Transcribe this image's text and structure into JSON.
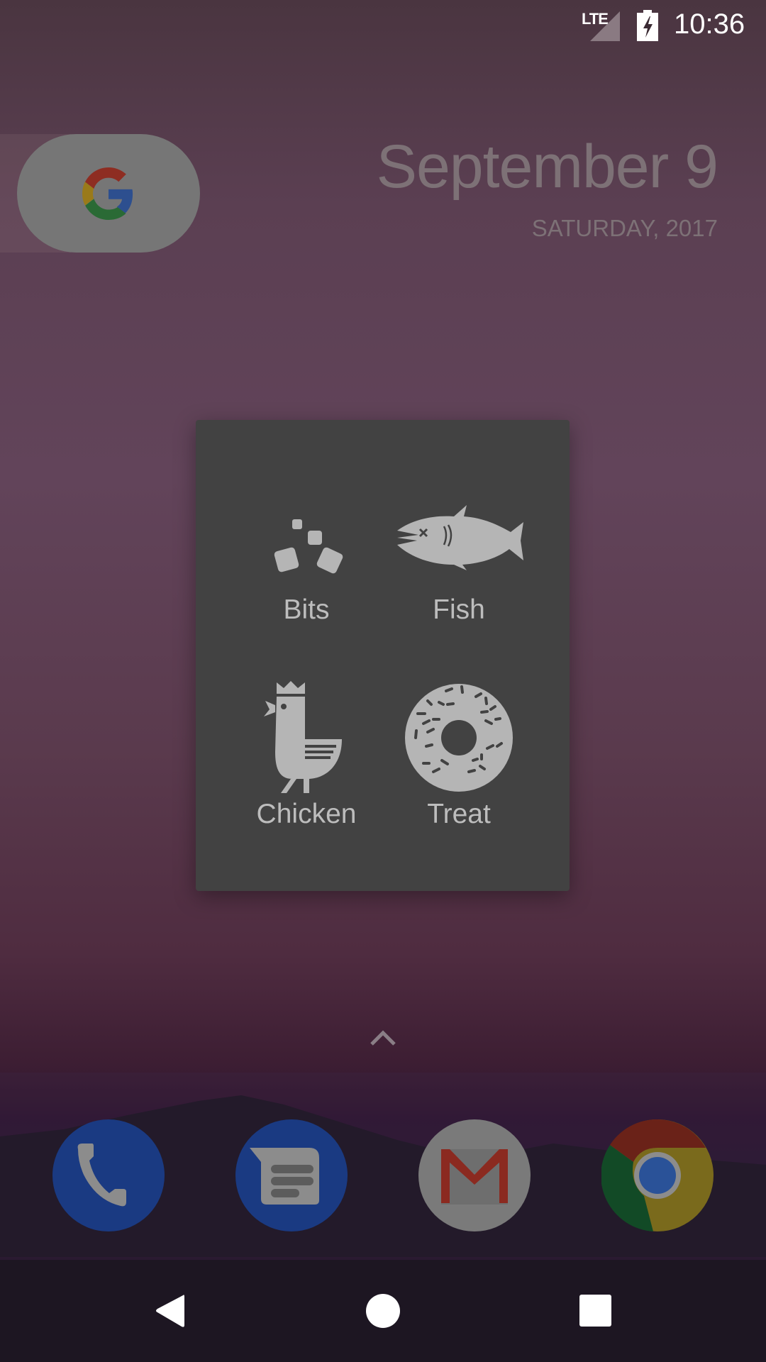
{
  "status_bar": {
    "network_label": "LTE",
    "time": "10:36",
    "icons": [
      "signal-icon",
      "battery-charging-icon"
    ]
  },
  "home": {
    "search_widget_icon": "google-g-icon",
    "date_primary": "September 9",
    "date_secondary": "SATURDAY, 2017",
    "app_drawer_icon": "chevron-up-icon"
  },
  "dialog": {
    "items": [
      {
        "label": "Bits",
        "icon": "bits-icon"
      },
      {
        "label": "Fish",
        "icon": "fish-icon"
      },
      {
        "label": "Chicken",
        "icon": "chicken-icon"
      },
      {
        "label": "Treat",
        "icon": "donut-icon"
      }
    ]
  },
  "dock": {
    "apps": [
      {
        "name": "Phone",
        "icon": "phone-icon"
      },
      {
        "name": "Messages",
        "icon": "messages-icon"
      },
      {
        "name": "Gmail",
        "icon": "gmail-icon"
      },
      {
        "name": "Chrome",
        "icon": "chrome-icon"
      }
    ]
  },
  "nav_bar": {
    "buttons": [
      "back-icon",
      "home-icon",
      "recents-icon"
    ]
  },
  "colors": {
    "dialog_bg": "#424242",
    "food_icon": "#b5b5b5",
    "dialog_label": "#bdbdbd",
    "date_text": "#7d7176"
  }
}
